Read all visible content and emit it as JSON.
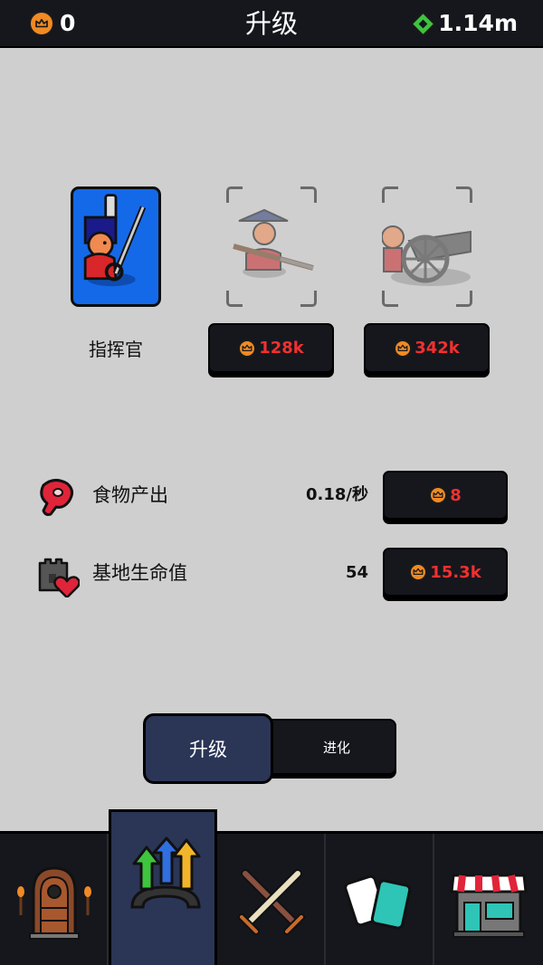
{
  "header": {
    "crowns": "0",
    "title": "升级",
    "gems": "1.14m"
  },
  "units": [
    {
      "name": "指挥官",
      "state": "unlocked",
      "icon": "commander-icon"
    },
    {
      "price": "128k",
      "state": "locked",
      "icon": "musketeer-icon"
    },
    {
      "price": "342k",
      "state": "locked",
      "icon": "cannon-icon"
    }
  ],
  "stats": [
    {
      "label": "食物产出",
      "value": "0.18/秒",
      "price": "8",
      "icon": "meat-icon"
    },
    {
      "label": "基地生命值",
      "value": "54",
      "price": "15.3k",
      "icon": "castle-heart-icon"
    }
  ],
  "tabs": {
    "upgrade": "升级",
    "evolve": "进化"
  },
  "nav": [
    "door-icon",
    "upgrade-arrows-icon",
    "crossed-swords-icon",
    "cards-icon",
    "shop-icon"
  ],
  "colors": {
    "price_red": "#f2302e",
    "crown_orange": "#f08a24",
    "gem_green": "#3ec43e",
    "active_tab": "#2b3556",
    "card_blue": "#1469e8"
  }
}
